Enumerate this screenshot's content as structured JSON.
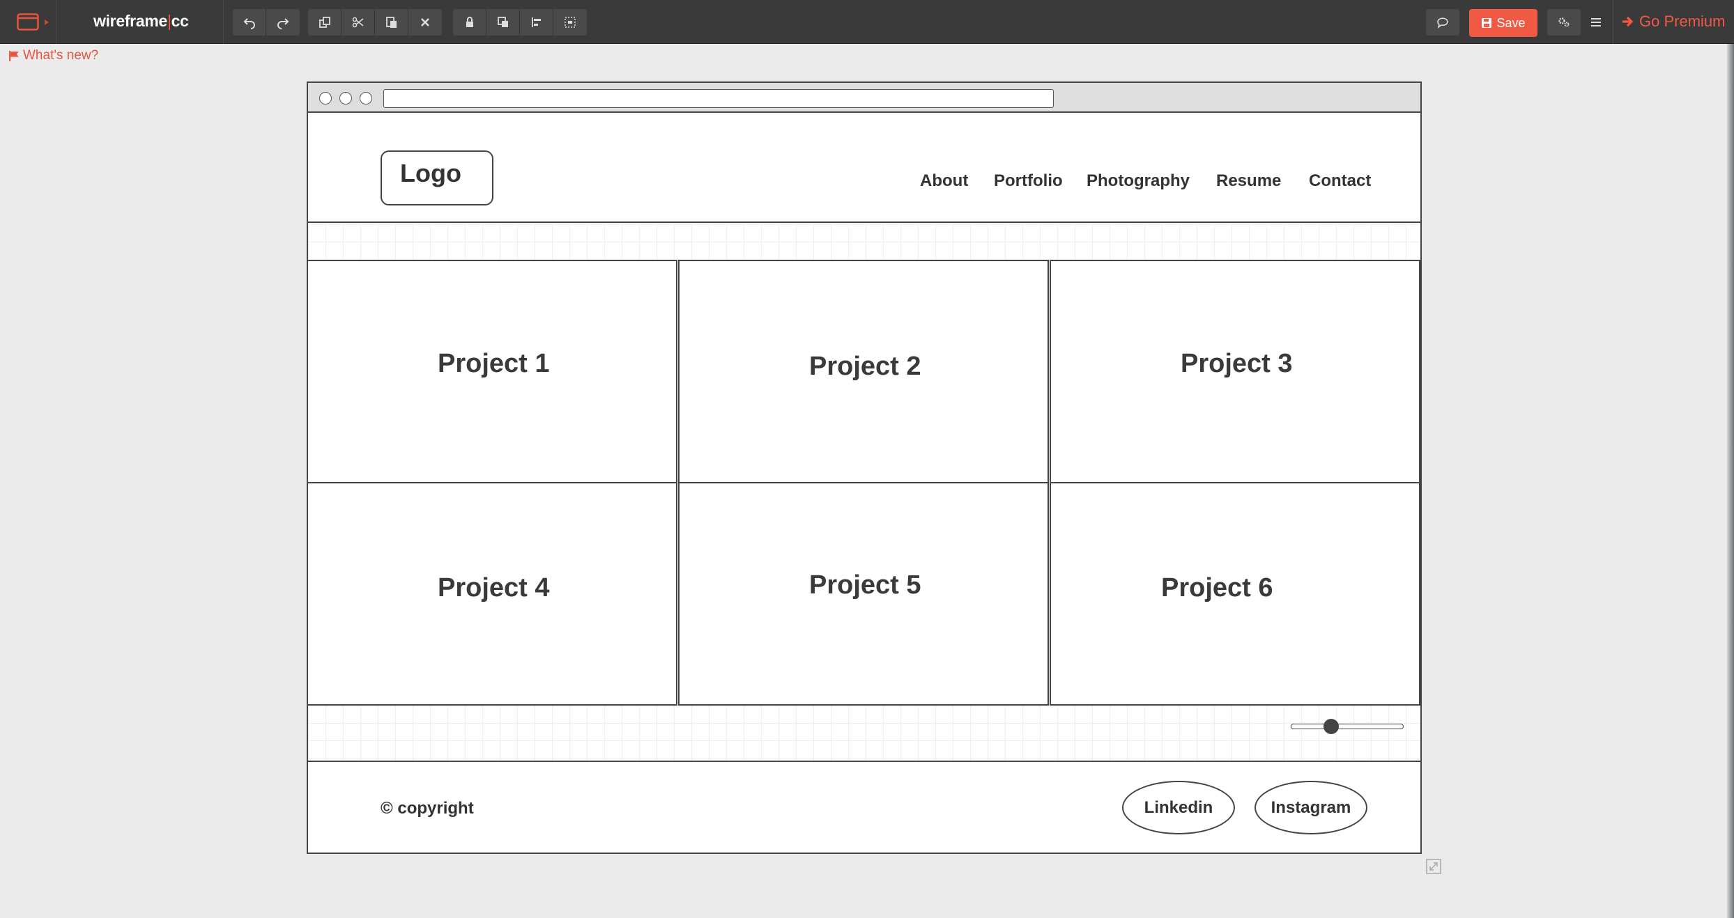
{
  "toolbar": {
    "brand_left": "wireframe",
    "brand_pipe": "|",
    "brand_right": "cc",
    "save_label": "Save",
    "premium_label": "Go Premium",
    "icons": [
      "undo-icon",
      "redo-icon",
      "duplicate-icon",
      "cut-icon",
      "paste-icon",
      "delete-icon",
      "lock-icon",
      "arrange-icon",
      "align-icon",
      "group-icon",
      "comment-icon",
      "settings-icon",
      "menu-icon"
    ]
  },
  "whats_new": "What's new?",
  "wireframe": {
    "logo": "Logo",
    "nav": [
      "About",
      "Portfolio",
      "Photography",
      "Resume",
      "Contact"
    ],
    "projects": [
      "Project 1",
      "Project 2",
      "Project 3",
      "Project 4",
      "Project 5",
      "Project 6"
    ],
    "slider_value": 0.36,
    "copyright": "© copyright",
    "social": [
      "Linkedin",
      "Instagram"
    ]
  },
  "colors": {
    "toolbar_bg": "#3a3a3a",
    "accent": "#f05a45",
    "canvas_bg": "#ebebeb",
    "stroke": "#444444"
  }
}
